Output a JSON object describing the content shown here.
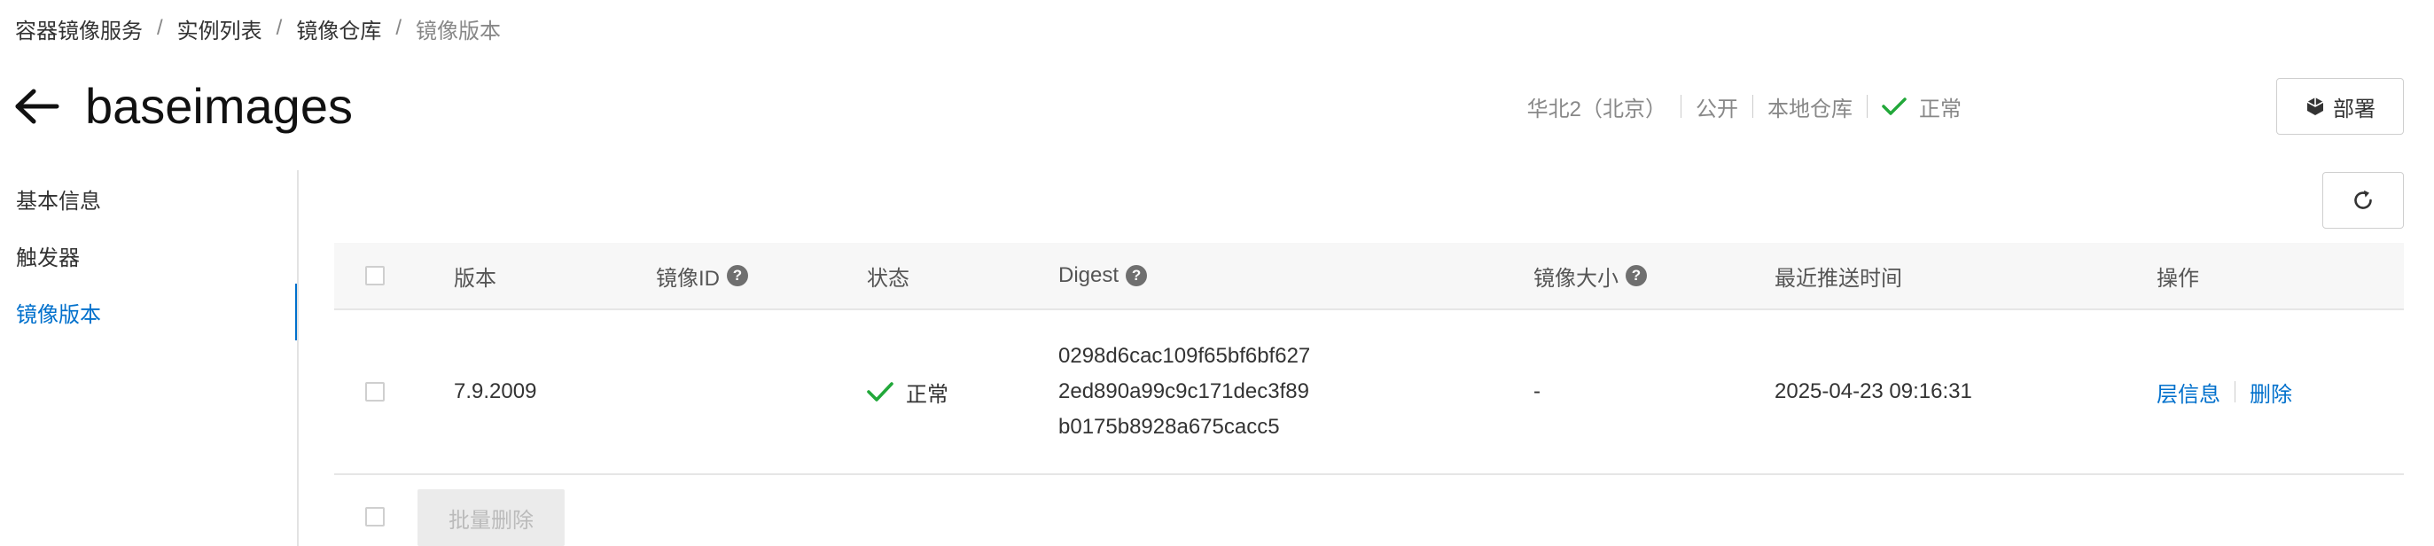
{
  "breadcrumb": {
    "items": [
      "容器镜像服务",
      "实例列表",
      "镜像仓库",
      "镜像版本"
    ],
    "separator": "/"
  },
  "header": {
    "back_icon": "arrow-left-icon",
    "title": "baseimages",
    "region": "华北2（北京）",
    "visibility": "公开",
    "repo_type": "本地仓库",
    "status": "正常",
    "status_icon": "check-icon",
    "deploy_icon": "cube-icon",
    "deploy_label": "部署"
  },
  "sidenav": {
    "items": [
      {
        "label": "基本信息",
        "active": false
      },
      {
        "label": "触发器",
        "active": false
      },
      {
        "label": "镜像版本",
        "active": true
      }
    ]
  },
  "toolbar": {
    "refresh_icon": "refresh-icon"
  },
  "table": {
    "columns": {
      "version": "版本",
      "image_id": "镜像ID",
      "status": "状态",
      "digest": "Digest",
      "size": "镜像大小",
      "pushed_at": "最近推送时间",
      "actions": "操作"
    },
    "help_glyph": "?",
    "rows": [
      {
        "version": "7.9.2009",
        "image_id": "",
        "status": "正常",
        "digest_lines": [
          "0298d6cac109f65bf6bf627",
          "2ed890a99c9c171dec3f89",
          "b0175b8928a675cacc5"
        ],
        "size": "-",
        "pushed_at": "2025-04-23 09:16:31",
        "action_layers": "层信息",
        "action_delete": "删除"
      }
    ]
  },
  "footer": {
    "batch_delete_label": "批量删除"
  },
  "colors": {
    "accent": "#0070cc",
    "success": "#22a83a",
    "border": "#e6e6e6",
    "header_bg": "#f7f7f7",
    "disabled_bg": "#ebebeb"
  }
}
